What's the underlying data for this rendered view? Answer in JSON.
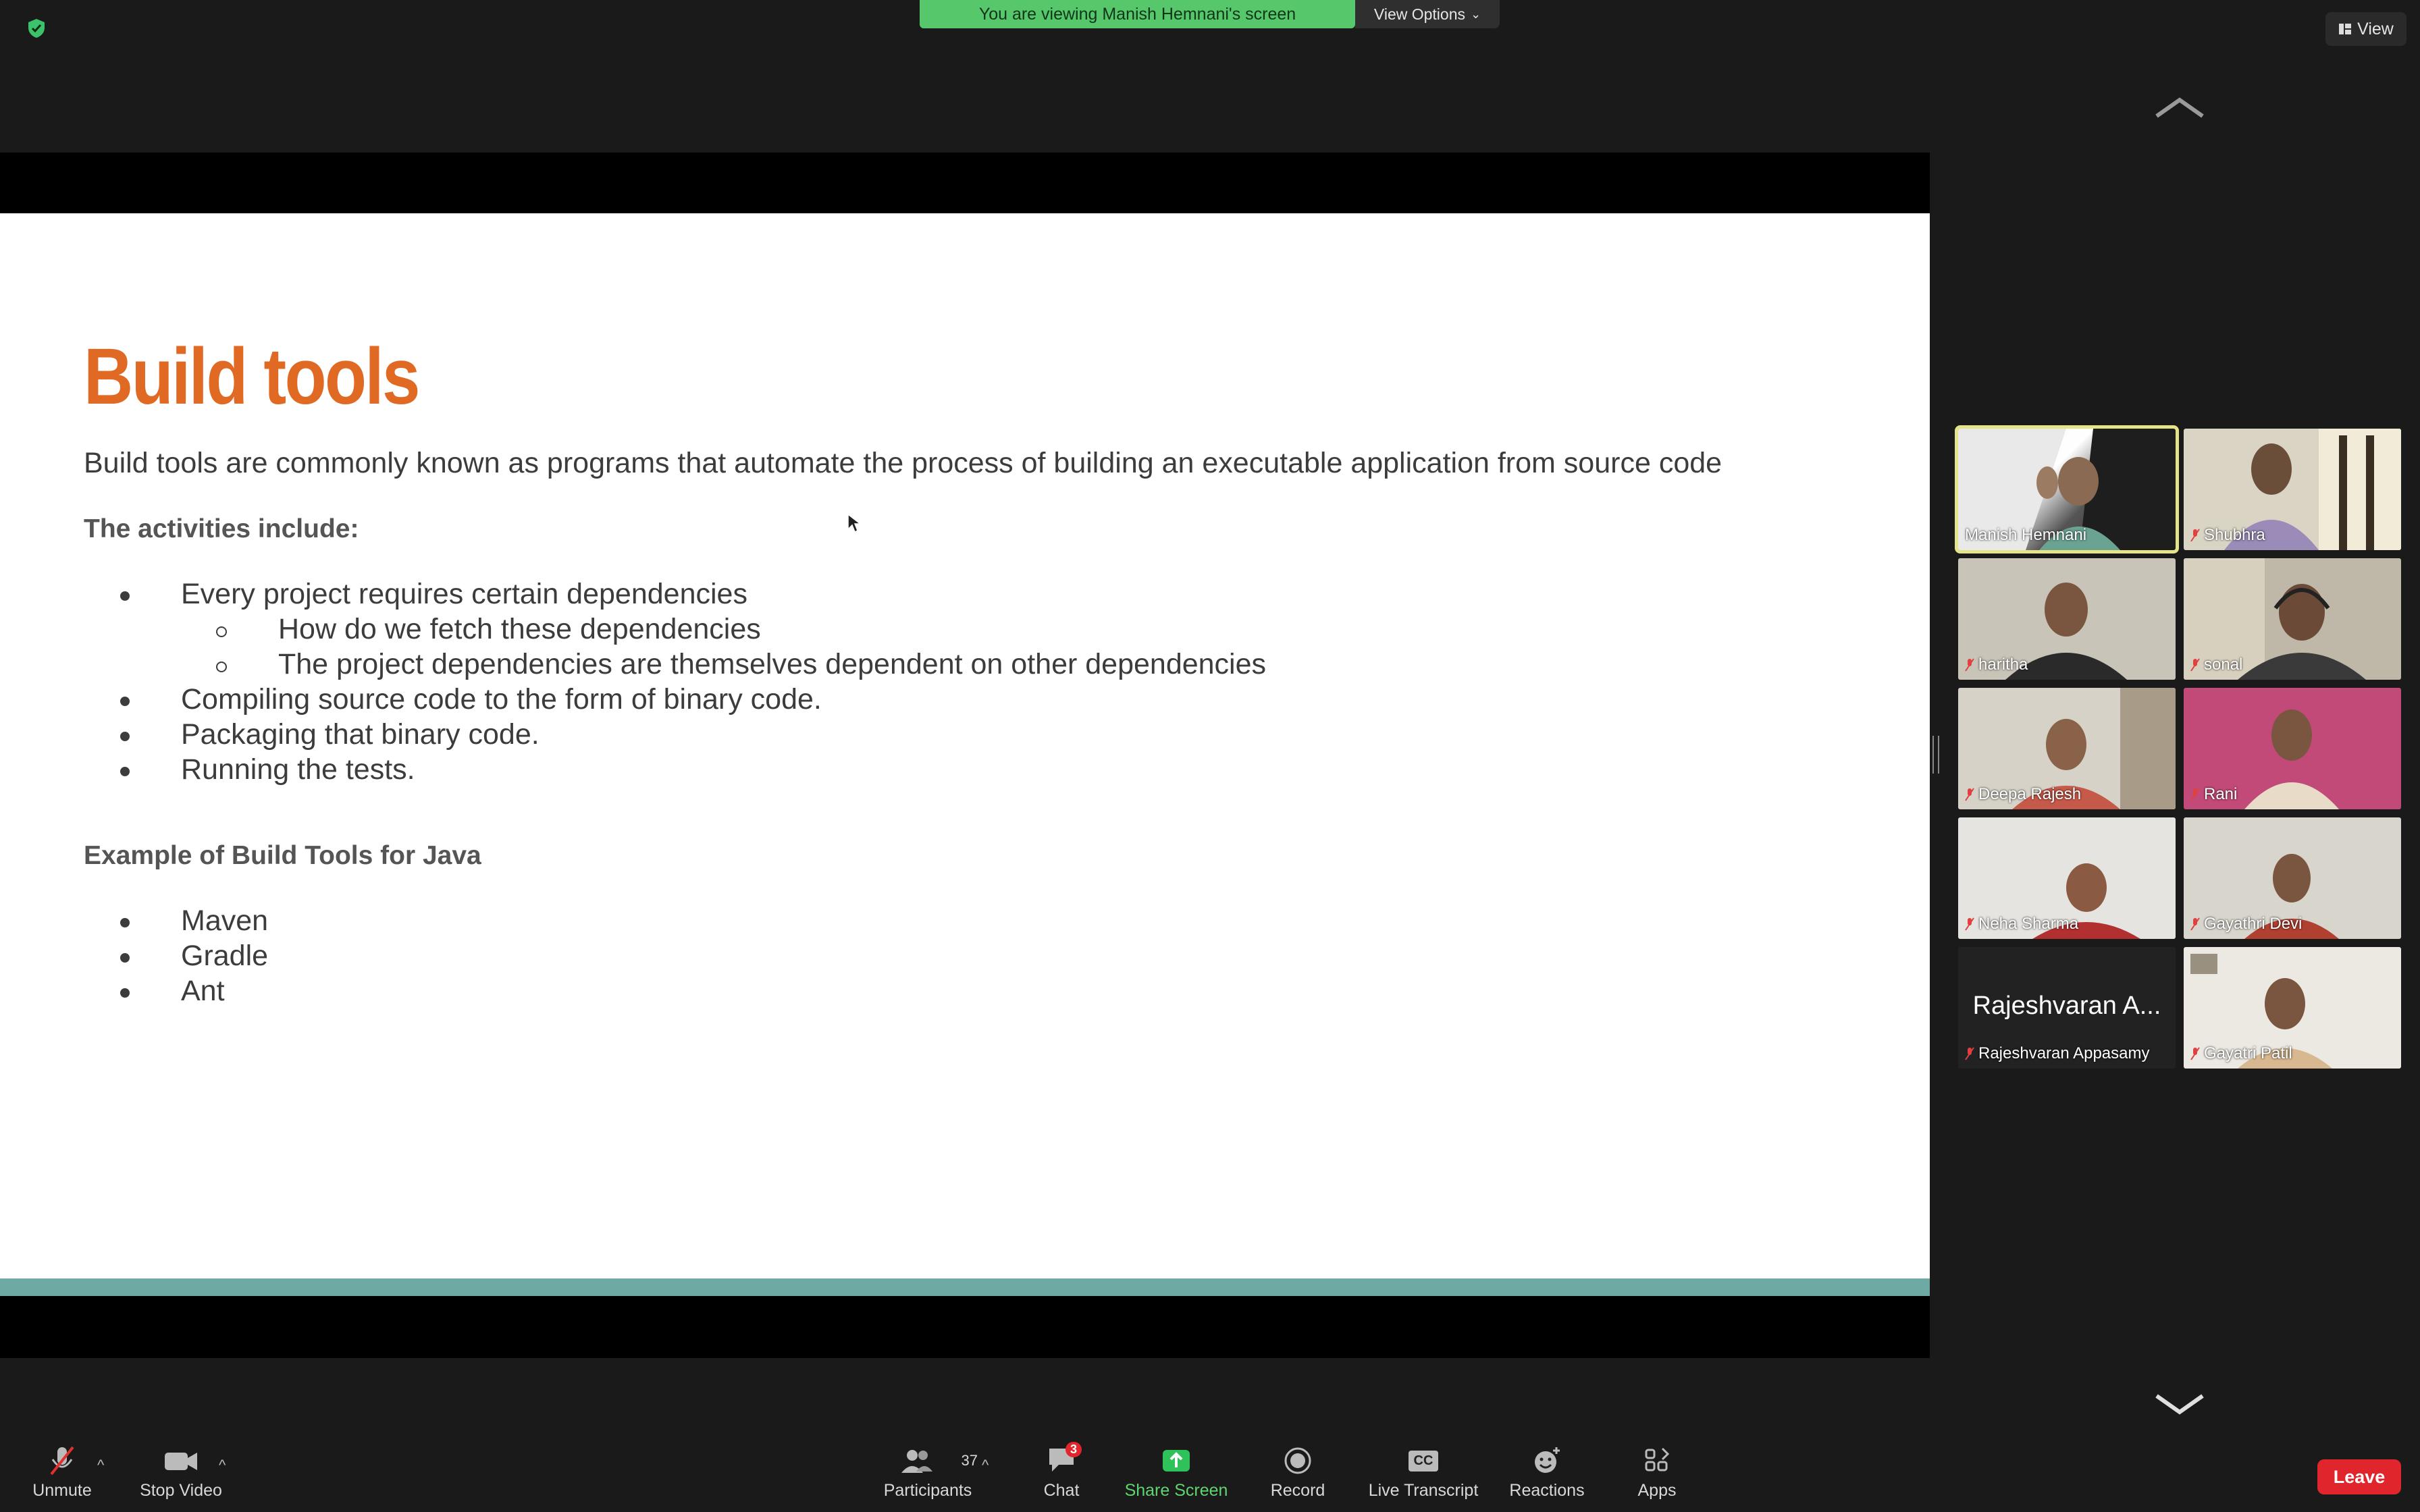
{
  "banner": {
    "viewing_text": "You are viewing Manish Hemnani's screen",
    "view_options_label": "View Options",
    "view_label": "View"
  },
  "slide": {
    "title": "Build tools",
    "subtitle": "Build tools are commonly known as programs that automate the process of building an executable application from source code",
    "activities_heading": "The activities include:",
    "activities": [
      "Every project requires certain dependencies",
      "How do we fetch these dependencies",
      "The project dependencies are themselves dependent on other dependencies",
      "Compiling source code to the form of binary code.",
      "Packaging that binary code.",
      "Running the tests."
    ],
    "example_heading": "Example of Build Tools for Java",
    "examples": [
      "Maven",
      "Gradle",
      "Ant"
    ]
  },
  "participants": [
    {
      "name": "Manish Hemnani",
      "muted": false,
      "active_speaker": true
    },
    {
      "name": "Shubhra",
      "muted": true
    },
    {
      "name": "haritha",
      "muted": true
    },
    {
      "name": "sonal",
      "muted": true
    },
    {
      "name": "Deepa Rajesh",
      "muted": true
    },
    {
      "name": "Rani",
      "muted": true
    },
    {
      "name": "Neha Sharma",
      "muted": true
    },
    {
      "name": "Gayathri Devi",
      "muted": true
    },
    {
      "name": "Rajeshvaran Appasamy",
      "muted": true,
      "display_text": "Rajeshvaran A..."
    },
    {
      "name": "Gayatri Patil",
      "muted": true
    }
  ],
  "toolbar": {
    "unmute": "Unmute",
    "stop_video": "Stop Video",
    "participants": "Participants",
    "participants_count": "37",
    "chat": "Chat",
    "chat_badge": "3",
    "share_screen": "Share Screen",
    "record": "Record",
    "live_transcript": "Live Transcript",
    "reactions": "Reactions",
    "apps": "Apps",
    "leave": "Leave",
    "cc_icon_text": "CC"
  },
  "colors": {
    "title_orange": "#e06a24",
    "banner_green": "#57c76b",
    "leave_red": "#e0262c",
    "stripe_teal": "#6fa9a3",
    "active_speaker_border": "#e6e48a"
  }
}
